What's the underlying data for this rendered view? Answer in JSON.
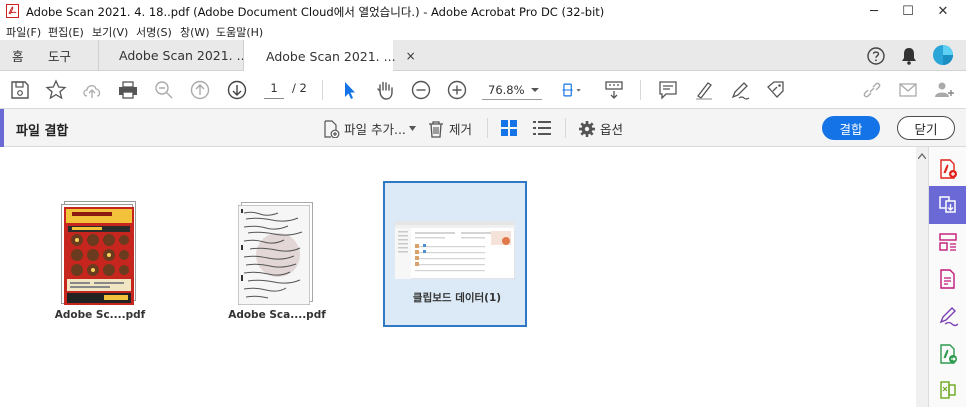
{
  "window": {
    "title": "Adobe Scan 2021. 4. 18..pdf (Adobe Document Cloud에서 열었습니다.) - Adobe Acrobat Pro DC (32-bit)",
    "minimize": "─",
    "maximize": "☐",
    "close": "✕"
  },
  "menu": [
    "파일(F)",
    "편집(E)",
    "보기(V)",
    "서명(S)",
    "창(W)",
    "도움말(H)"
  ],
  "tabs": {
    "home": "홈",
    "tools": "도구",
    "doc1": "Adobe Scan 2021. ...",
    "doc2": "Adobe Scan 2021. ...",
    "close": "×"
  },
  "toolbar": {
    "page_current": "1",
    "page_total": "/ 2",
    "zoom": "76.8%"
  },
  "combine": {
    "title": "파일 결합",
    "add_files": "파일 추가...",
    "remove": "제거",
    "options": "옵션",
    "combine_btn": "결합",
    "close_btn": "닫기"
  },
  "files": [
    {
      "label": "Adobe Sc....pdf"
    },
    {
      "label": "Adobe Sca....pdf"
    },
    {
      "label": "클립보드 데이터(1)"
    }
  ],
  "colors": {
    "accent_purple": "#6b69d6",
    "primary_blue": "#1473e6",
    "selection_blue": "#2f78c4",
    "acrobat_red": "#e2231a"
  }
}
